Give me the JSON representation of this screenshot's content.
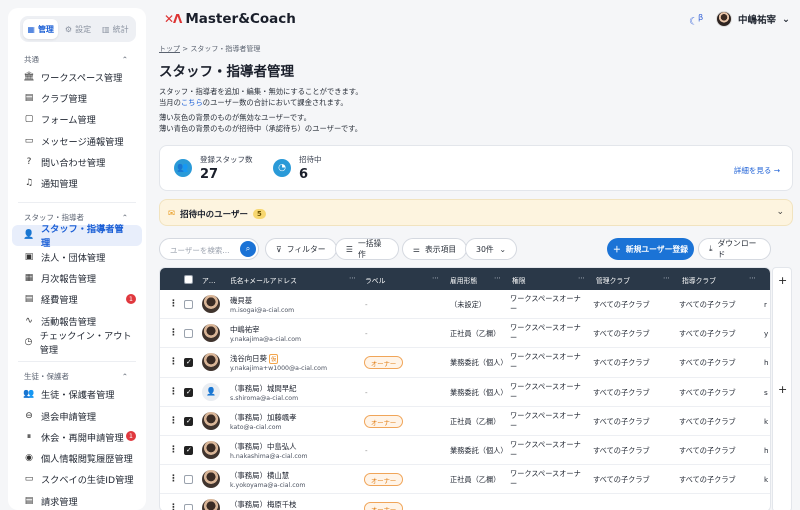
{
  "sidebar": {
    "tabs": [
      {
        "label": "管理",
        "icon": "grid-icon"
      },
      {
        "label": "設定",
        "icon": "gear-icon"
      },
      {
        "label": "統計",
        "icon": "bar-chart-icon"
      }
    ],
    "sections": [
      {
        "title": "共通",
        "items": [
          {
            "label": "ワークスペース管理",
            "icon": "building-icon"
          },
          {
            "label": "クラブ管理",
            "icon": "document-icon"
          },
          {
            "label": "フォーム管理",
            "icon": "form-icon"
          },
          {
            "label": "メッセージ通報管理",
            "icon": "chat-icon"
          },
          {
            "label": "問い合わせ管理",
            "icon": "question-chat-icon"
          },
          {
            "label": "通知管理",
            "icon": "bell-icon"
          }
        ]
      },
      {
        "title": "スタッフ・指導者",
        "items": [
          {
            "label": "スタッフ・指導者管理",
            "icon": "users-icon",
            "active": true
          },
          {
            "label": "法人・団体管理",
            "icon": "org-icon"
          },
          {
            "label": "月次報告管理",
            "icon": "calendar-icon"
          },
          {
            "label": "経費管理",
            "icon": "receipt-icon",
            "badge": "1"
          },
          {
            "label": "活動報告管理",
            "icon": "activity-icon"
          },
          {
            "label": "チェックイン・アウト管理",
            "icon": "clock-icon"
          }
        ]
      },
      {
        "title": "生徒・保護者",
        "items": [
          {
            "label": "生徒・保護者管理",
            "icon": "user-group-icon"
          },
          {
            "label": "退会申請管理",
            "icon": "user-minus-icon"
          },
          {
            "label": "休会・再開申請管理",
            "icon": "pause-circle-icon",
            "badge": "1"
          },
          {
            "label": "個人情報閲覧履歴管理",
            "icon": "eye-icon"
          },
          {
            "label": "スクベイの生徒ID管理",
            "icon": "id-card-icon"
          },
          {
            "label": "請求管理",
            "icon": "invoice-icon"
          }
        ]
      }
    ]
  },
  "header": {
    "app_name": "Master&Coach",
    "theme_badge": "β",
    "user_name": "中嶋祐宰"
  },
  "page": {
    "breadcrumb_home": "トップ",
    "breadcrumb_sep": ">",
    "breadcrumb_current": "スタッフ・指導者管理",
    "title": "スタッフ・指導者管理",
    "desc1": "スタッフ・指導者を追加・編集・無効にすることができます。",
    "desc2_a": "当月の",
    "desc2_link": "こちら",
    "desc2_b": "のユーザー数の合計において課金されます。",
    "desc3": "薄い灰色の背景のものが無効なユーザーです。",
    "desc4": "薄い青色の背景のものが招待中（承認待ち）のユーザーです。"
  },
  "stats": {
    "registered_label": "登録スタッフ数",
    "registered_value": "27",
    "invited_label": "招待中",
    "invited_value": "6",
    "more_label": "詳細を見る →"
  },
  "invite_panel": {
    "label": "招待中のユーザー",
    "count": "5"
  },
  "toolbar": {
    "search_placeholder": "ユーザーを検索...",
    "filter_label": "フィルター",
    "bulk_label": "一括操作",
    "columns_label": "表示項目",
    "page_size": "30件",
    "new_user_label": "新規ユーザー登録",
    "download_label": "ダウンロード"
  },
  "table": {
    "headers": {
      "a": "ア…",
      "name": "氏名+メールアドレス",
      "label": "ラベル",
      "emp": "雇用形態",
      "role": "権限",
      "mclub": "管理クラブ",
      "gclub": "指導クラブ"
    },
    "rows": [
      {
        "name": "磯貝基",
        "email": "m.isogai@a-cial.com",
        "label": "-",
        "emp": "（未設定）",
        "role": "ワークスペースオーナー",
        "mclub": "すべての子クラブ",
        "gclub": "すべての子クラブ",
        "more": "r",
        "checked": false,
        "avatar": "photo"
      },
      {
        "name": "中嶋祐宰",
        "email": "y.nakajima@a-cial.com",
        "label": "-",
        "emp": "正社員（乙欄）",
        "role": "ワークスペースオーナー",
        "mclub": "すべての子クラブ",
        "gclub": "すべての子クラブ",
        "more": "y",
        "checked": false,
        "avatar": "photo"
      },
      {
        "name": "浅谷向日葵",
        "tag": "仮",
        "email": "y.nakajima+w1000@a-cial.com",
        "label": "オーナー",
        "emp": "業務委託（個人）",
        "role": "ワークスペースオーナー",
        "mclub": "すべての子クラブ",
        "gclub": "すべての子クラブ",
        "more": "h",
        "checked": true,
        "avatar": "photo"
      },
      {
        "name": "（事務局）城間早紀",
        "email": "s.shiroma@a-cial.com",
        "label": "-",
        "emp": "業務委託（個人）",
        "role": "ワークスペースオーナー",
        "mclub": "すべての子クラブ",
        "gclub": "すべての子クラブ",
        "more": "s",
        "checked": true,
        "avatar": "default"
      },
      {
        "name": "（事務局）加藤颯孝",
        "email": "kato@a-cial.com",
        "label": "オーナー",
        "emp": "正社員（乙欄）",
        "role": "ワークスペースオーナー",
        "mclub": "すべての子クラブ",
        "gclub": "すべての子クラブ",
        "more": "k",
        "checked": true,
        "avatar": "photo"
      },
      {
        "name": "（事務局）中島弘人",
        "email": "h.nakashima@a-cial.com",
        "label": "-",
        "emp": "業務委託（個人）",
        "role": "ワークスペースオーナー",
        "mclub": "すべての子クラブ",
        "gclub": "すべての子クラブ",
        "more": "h",
        "checked": true,
        "avatar": "photo"
      },
      {
        "name": "（事務局）横山慧",
        "email": "k.yokoyama@a-cial.com",
        "label": "オーナー",
        "emp": "正社員（乙欄）",
        "role": "ワークスペースオーナー",
        "mclub": "すべての子クラブ",
        "gclub": "すべての子クラブ",
        "more": "k",
        "checked": false,
        "avatar": "photo"
      },
      {
        "name": "（事務局）梅原千枝",
        "email": "",
        "label": "オーナー",
        "emp": "",
        "role": "",
        "mclub": "",
        "gclub": "",
        "more": "",
        "checked": false,
        "avatar": "photo"
      }
    ]
  }
}
